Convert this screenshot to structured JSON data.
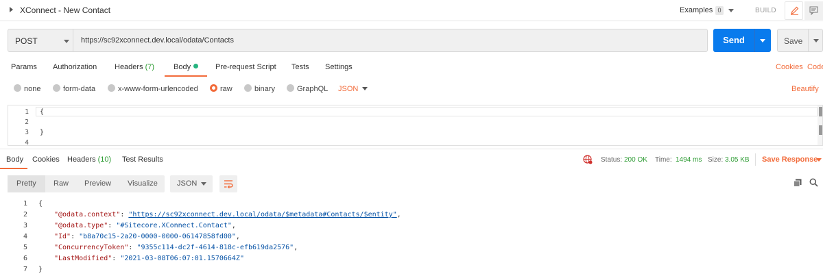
{
  "tab": {
    "title": "XConnect - New Contact"
  },
  "header": {
    "examples_label": "Examples",
    "examples_count": "0",
    "build_label": "BUILD"
  },
  "request": {
    "method": "POST",
    "url": "https://sc92xconnect.dev.local/odata/Contacts",
    "send_label": "Send",
    "save_label": "Save"
  },
  "request_tabs": [
    {
      "label": "Params"
    },
    {
      "label": "Authorization"
    },
    {
      "label": "Headers",
      "count": "(7)"
    },
    {
      "label": "Body"
    },
    {
      "label": "Pre-request Script"
    },
    {
      "label": "Tests"
    },
    {
      "label": "Settings"
    }
  ],
  "request_links": {
    "cookies": "Cookies",
    "code": "Code"
  },
  "body_modes": [
    {
      "label": "none",
      "selected": false
    },
    {
      "label": "form-data",
      "selected": false
    },
    {
      "label": "x-www-form-urlencoded",
      "selected": false
    },
    {
      "label": "raw",
      "selected": true
    },
    {
      "label": "binary",
      "selected": false
    },
    {
      "label": "GraphQL",
      "selected": false
    }
  ],
  "body_format": "JSON",
  "beautify_label": "Beautify",
  "request_body": {
    "line_numbers": [
      "1",
      "2",
      "3",
      "4"
    ],
    "lines": [
      "{",
      "",
      "}",
      ""
    ]
  },
  "response_tabs": [
    {
      "label": "Body"
    },
    {
      "label": "Cookies"
    },
    {
      "label": "Headers",
      "count": "(10)"
    },
    {
      "label": "Test Results"
    }
  ],
  "status": {
    "status_label": "Status:",
    "status_value": "200 OK",
    "time_label": "Time:",
    "time_value": "1494 ms",
    "size_label": "Size:",
    "size_value": "3.05 KB",
    "save_response": "Save Response"
  },
  "view_tabs": [
    {
      "label": "Pretty"
    },
    {
      "label": "Raw"
    },
    {
      "label": "Preview"
    },
    {
      "label": "Visualize"
    }
  ],
  "view_format": "JSON",
  "response_body": {
    "line_numbers": [
      "1",
      "2",
      "3",
      "4",
      "5",
      "6",
      "7"
    ],
    "open": "{",
    "close": "}",
    "entries": [
      {
        "key": "\"@odata.context\"",
        "value": "\"https://sc92xconnect.dev.local/odata/$metadata#Contacts/$entity\""
      },
      {
        "key": "\"@odata.type\"",
        "value": "\"#Sitecore.XConnect.Contact\""
      },
      {
        "key": "\"Id\"",
        "value": "\"b8a70c15-2a20-0000-0000-06147858fd00\""
      },
      {
        "key": "\"ConcurrencyToken\"",
        "value": "\"9355c114-dc2f-4614-818c-efb619da2576\""
      },
      {
        "key": "\"LastModified\"",
        "value": "\"2021-03-08T06:07:01.1570664Z\""
      }
    ]
  },
  "colors": {
    "accent": "#f26b3a",
    "send": "#097bed",
    "success": "#2e9c34",
    "json_key": "#a31515",
    "json_string": "#0451a5"
  }
}
